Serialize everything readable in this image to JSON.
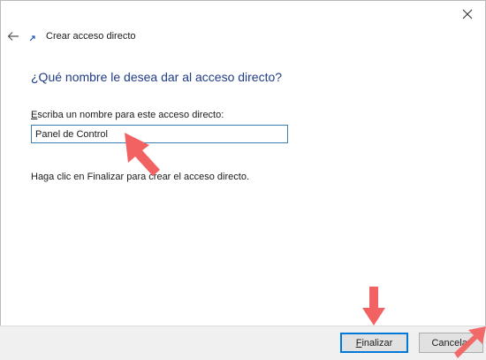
{
  "window": {
    "title": "Crear acceso directo"
  },
  "wizard": {
    "heading": "¿Qué nombre le desea dar al acceso directo?",
    "field_label_mnemonic": "E",
    "field_label_rest": "scriba un nombre para este acceso directo:",
    "name_value": "Panel de Control",
    "hint": "Haga clic en Finalizar para crear el acceso directo."
  },
  "buttons": {
    "finish_mnemonic": "F",
    "finish_rest": "inalizar",
    "cancel": "Cancelar"
  },
  "icons": {
    "close": "close-icon",
    "back": "back-arrow-icon",
    "shortcut": "shortcut-icon",
    "annotation": "annotation-arrow-icon"
  },
  "colors": {
    "heading": "#1f3c88",
    "input_border": "#3c7fb1",
    "default_button_border": "#0078d7",
    "annotation_arrow": "#f26262",
    "footer": "#f0f0f0"
  }
}
